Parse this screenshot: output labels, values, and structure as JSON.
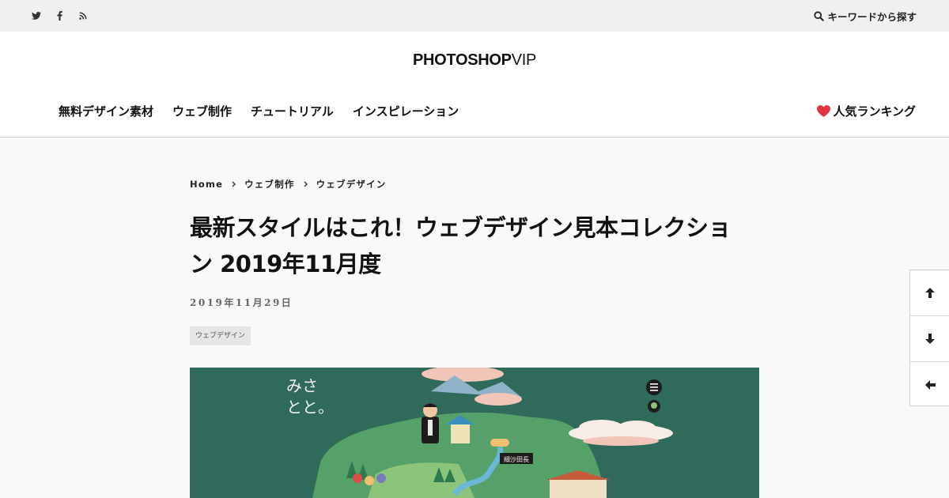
{
  "topbar": {
    "social": [
      "twitter-icon",
      "facebook-icon",
      "rss-icon"
    ],
    "search_label": "キーワードから探す"
  },
  "header": {
    "logo_bold": "PHOTOSHOP",
    "logo_light": "VIP",
    "nav": [
      "無料デザイン素材",
      "ウェブ制作",
      "チュートリアル",
      "インスピレーション"
    ],
    "ranking_label": "人気ランキング"
  },
  "article": {
    "breadcrumb": [
      "Home",
      "ウェブ制作",
      "ウェブデザイン"
    ],
    "title_line1": "最新スタイルはこれ！ウェブデザイン見本コレクショ",
    "title_line2": "ン 2019年11月度",
    "date": "2019年11月29日",
    "tag": "ウェブデザイン"
  },
  "hero": {
    "calligraphy_line1": "みさ",
    "calligraphy_line2": "とと。",
    "sign_text": "細沙田長"
  },
  "floating_nav": [
    "arrow-up-icon",
    "arrow-down-icon",
    "arrow-left-icon"
  ],
  "colors": {
    "topbar_bg": "#f0f0f0",
    "page_bg": "#f9f9f9",
    "hero_bg": "#2f6a5a",
    "heart": "#e03540"
  }
}
